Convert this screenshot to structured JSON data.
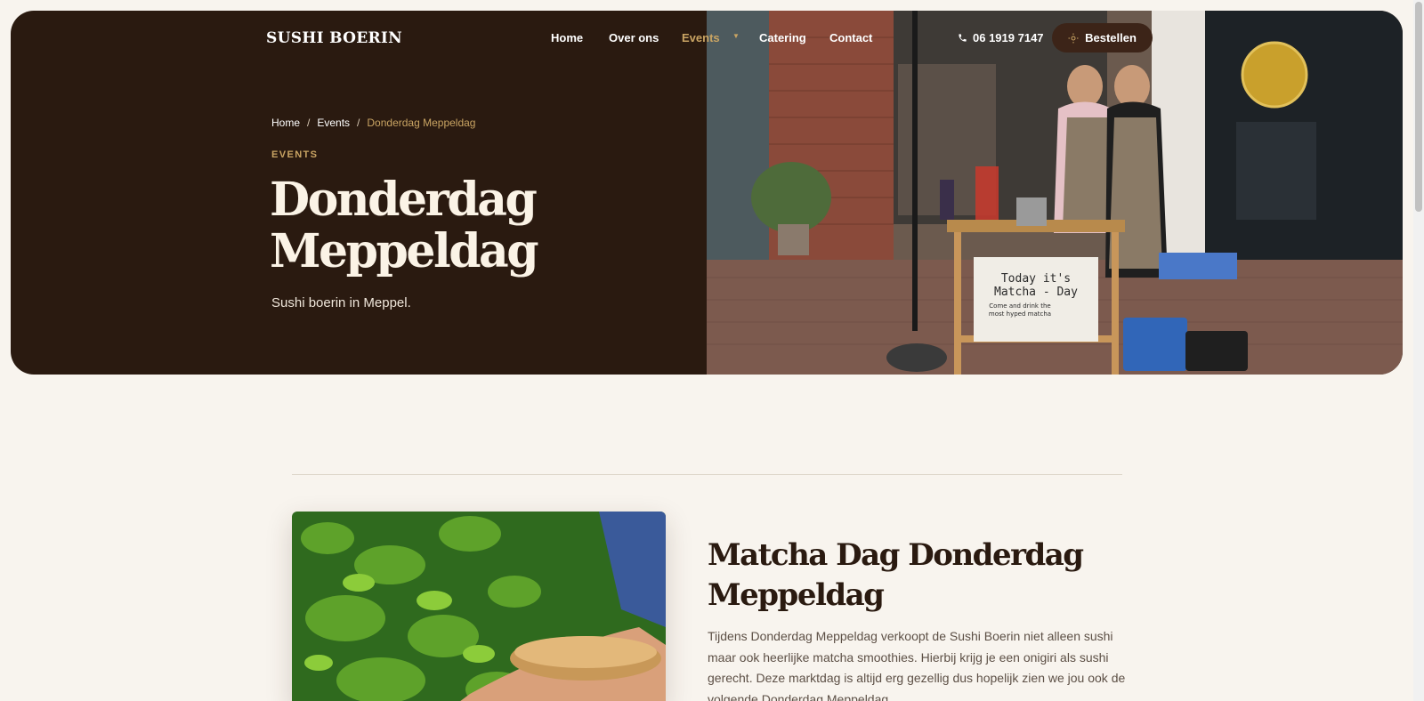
{
  "header": {
    "brand": "SUSHI BOERIN",
    "nav": {
      "home": "Home",
      "about": "Over ons",
      "events": "Events",
      "catering": "Catering",
      "contact": "Contact"
    },
    "phone": "06 1919 7147",
    "order_label": "Bestellen"
  },
  "hero": {
    "breadcrumb": {
      "home": "Home",
      "sep": "/",
      "events": "Events",
      "current": "Donderdag Meppeldag"
    },
    "kicker": "EVENTS",
    "title_line1": "Donderdag",
    "title_line2": "Meppeldag",
    "subtitle": "Sushi boerin in Meppel.",
    "photo_sign": {
      "line1": "Today it's",
      "line2": "Matcha - Day",
      "line3": "Come and drink the",
      "line4": "most hyped matcha"
    }
  },
  "section": {
    "title_line1": "Matcha Dag Donderdag",
    "title_line2": "Meppeldag",
    "body": "Tijdens Donderdag Meppeldag verkoopt de Sushi Boerin niet alleen sushi maar ook heerlijke matcha smoothies. Hierbij krijg je een onigiri als sushi gerecht. Deze marktdag is altijd erg gezellig dus hopelijk zien we jou ook de volgende Donderdag Meppeldag."
  },
  "colors": {
    "hero_bg": "#2a1a10",
    "accent_gold": "#c9a463",
    "page_bg": "#f8f4ee",
    "order_button": "#3c2418"
  }
}
